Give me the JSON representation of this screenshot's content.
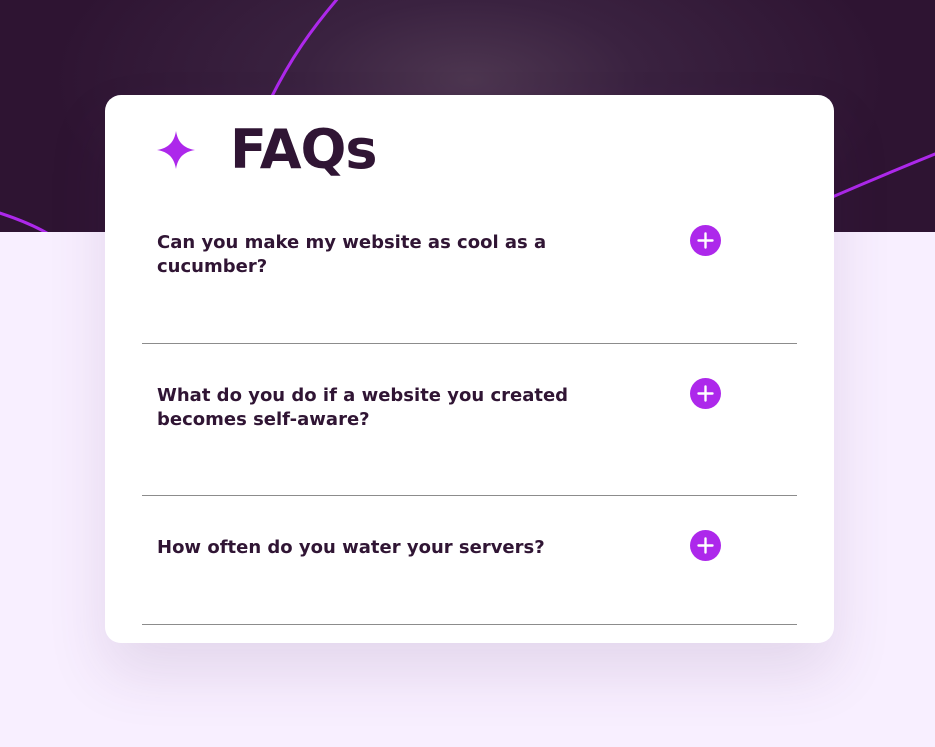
{
  "page": {
    "title": "FAQs"
  },
  "colors": {
    "accent": "#ad28eb",
    "heading": "#301534",
    "hero_background": "#2e1432",
    "page_background": "#f8efff",
    "divider": "#8c8c8c"
  },
  "icons": {
    "header": "four-point-star-icon",
    "toggle": "plus-circle-icon"
  },
  "faqs": [
    {
      "question": "Can you make my website as cool as a cucumber?",
      "expanded": false
    },
    {
      "question": "What do you do if a website you created becomes self-aware?",
      "expanded": false
    },
    {
      "question": "How often do you water your servers?",
      "expanded": false
    }
  ]
}
